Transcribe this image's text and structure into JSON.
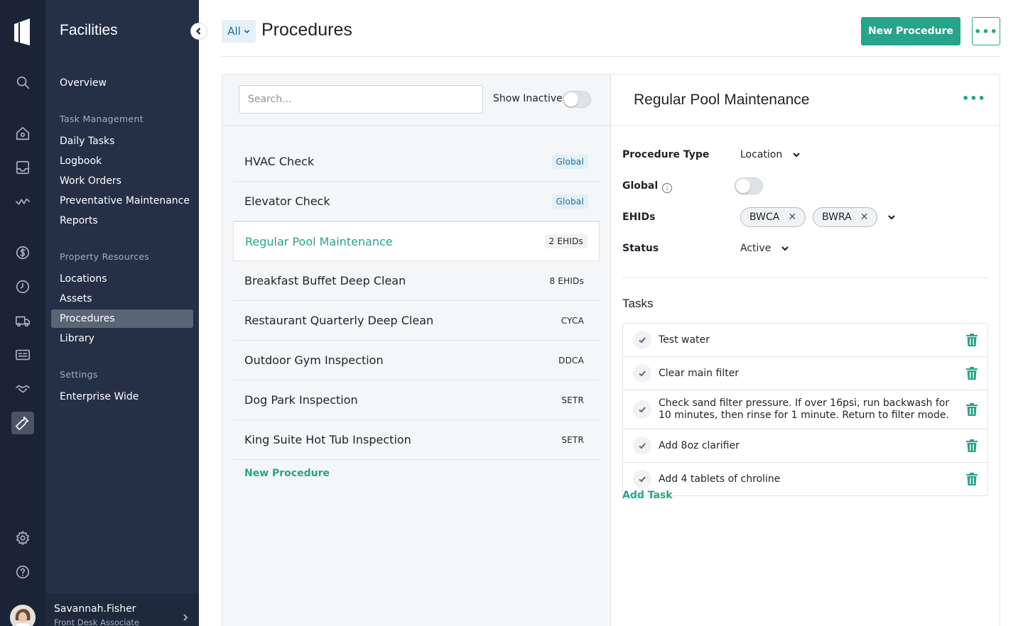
{
  "sidebar": {
    "title": "Facilities",
    "items_top": [
      {
        "label": "Overview"
      }
    ],
    "groups": [
      {
        "label": "Task Management",
        "items": [
          "Daily Tasks",
          "Logbook",
          "Work Orders",
          "Preventative Maintenance",
          "Reports"
        ]
      },
      {
        "label": "Property Resources",
        "items": [
          "Locations",
          "Assets",
          "Procedures",
          "Library"
        ]
      },
      {
        "label": "Settings",
        "items": [
          "Enterprise Wide"
        ]
      }
    ],
    "active_item": "Procedures",
    "user": {
      "name": "Savannah.Fisher",
      "role": "Front Desk Associate"
    }
  },
  "rail_icons": [
    "logo-icon",
    "search-icon",
    "home-icon",
    "inbox-icon",
    "activity-icon",
    "dollar-icon",
    "clock-icon",
    "truck-icon",
    "id-card-icon",
    "handshake-icon",
    "wrench-icon",
    "settings-icon",
    "help-icon"
  ],
  "header": {
    "filter_label": "All",
    "title": "Procedures",
    "new_button": "New Procedure",
    "more_label": "•••"
  },
  "list": {
    "search_placeholder": "Search...",
    "show_inactive_label": "Show Inactive",
    "show_inactive_on": false,
    "procedures": [
      {
        "name": "HVAC Check",
        "tag": "Global",
        "tag_type": "global"
      },
      {
        "name": "Elevator Check",
        "tag": "Global",
        "tag_type": "global"
      },
      {
        "name": "Regular Pool Maintenance",
        "tag": "2 EHIDs",
        "tag_type": "count",
        "selected": true
      },
      {
        "name": "Breakfast Buffet Deep Clean",
        "tag": "8 EHIDs",
        "tag_type": "plain"
      },
      {
        "name": "Restaurant Quarterly Deep Clean",
        "tag": "CYCA",
        "tag_type": "plain"
      },
      {
        "name": "Outdoor Gym Inspection",
        "tag": "DDCA",
        "tag_type": "plain"
      },
      {
        "name": "Dog Park Inspection",
        "tag": "SETR",
        "tag_type": "plain"
      },
      {
        "name": "King Suite Hot Tub Inspection",
        "tag": "SETR",
        "tag_type": "plain"
      }
    ],
    "new_link": "New Procedure"
  },
  "detail": {
    "title": "Regular Pool Maintenance",
    "more_label": "•••",
    "fields": {
      "procedure_type_label": "Procedure Type",
      "procedure_type_value": "Location",
      "global_label": "Global",
      "global_on": false,
      "ehids_label": "EHIDs",
      "ehids": [
        "BWCA",
        "BWRA"
      ],
      "status_label": "Status",
      "status_value": "Active"
    },
    "tasks_heading": "Tasks",
    "tasks": [
      "Test water",
      "Clear main filter",
      "Check sand filter pressure. If over 16psi, run backwash for 10 minutes, then rinse for 1 minute. Return to filter mode.",
      "Add 8oz clarifier",
      "Add 4 tablets of chroline"
    ],
    "add_task": "Add Task"
  },
  "colors": {
    "accent": "#27a489",
    "rail": "#1b2437",
    "sidebar": "#253047",
    "info_blue": "#1f6e9c"
  }
}
